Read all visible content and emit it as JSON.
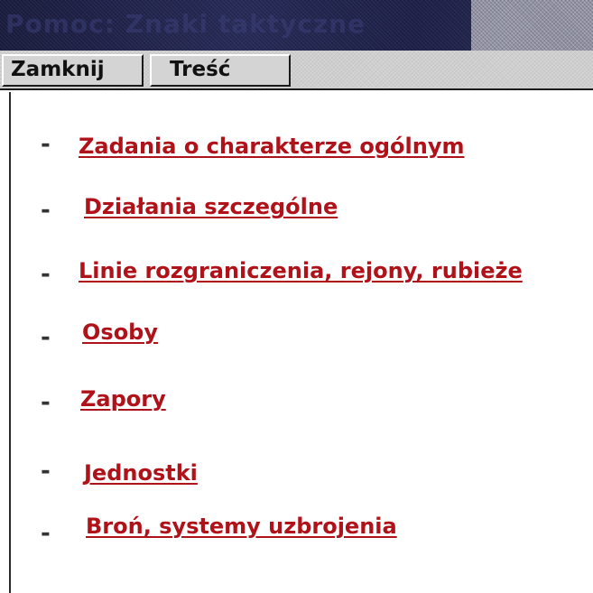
{
  "window": {
    "title": "Pomoc: Znaki taktyczne"
  },
  "toolbar": {
    "close_label": "Zamknij",
    "contents_label": "Treść"
  },
  "colors": {
    "link": "#b0121a",
    "titlebar": "#1d2048",
    "toolbar": "#cfcfcf",
    "background": "#ffffff"
  },
  "links": [
    {
      "label": "Zadania o charakterze ogólnym"
    },
    {
      "label": "Działania szczególne"
    },
    {
      "label": "Linie rozgraniczenia, rejony, rubieże"
    },
    {
      "label": "Osoby"
    },
    {
      "label": "Zapory"
    },
    {
      "label": "Jednostki"
    },
    {
      "label": "Broń, systemy uzbrojenia"
    }
  ],
  "bullet": "-"
}
